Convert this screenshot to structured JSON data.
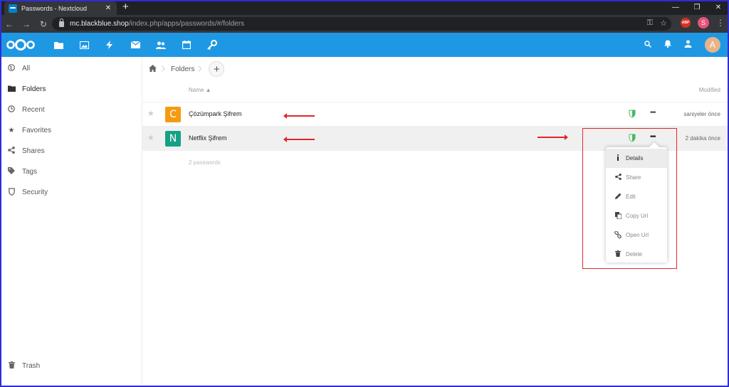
{
  "browser": {
    "tab_title": "Passwords - Nextcloud",
    "new_tab": "+",
    "tab_close": "✕",
    "url_host": "mc.blackblue.shop",
    "url_path": "/index.php/apps/passwords/#/folders",
    "profile_initial": "S",
    "abp_label": "ABP",
    "window_controls": {
      "minimize": "—",
      "maximize": "❐",
      "close": "✕"
    }
  },
  "header": {
    "avatar_initial": "A"
  },
  "sidebar": {
    "items": [
      {
        "label": "All",
        "icon": "globe-icon"
      },
      {
        "label": "Folders",
        "icon": "folder-icon"
      },
      {
        "label": "Recent",
        "icon": "clock-icon"
      },
      {
        "label": "Favorites",
        "icon": "star-icon"
      },
      {
        "label": "Shares",
        "icon": "share-icon"
      },
      {
        "label": "Tags",
        "icon": "tag-icon"
      },
      {
        "label": "Security",
        "icon": "shield-icon"
      }
    ],
    "trash_label": "Trash"
  },
  "breadcrumb": {
    "current": "Folders",
    "add": "+"
  },
  "table": {
    "col_name": "Name ▲",
    "col_modified": "Modified",
    "rows": [
      {
        "letter": "C",
        "letter_color": "#f39c12",
        "title": "Çözümpark Şifrem",
        "modified": "saniyeler önce",
        "shield_color": "#46ba61"
      },
      {
        "letter": "N",
        "letter_color": "#16a085",
        "title": "Netflix Şifrem",
        "modified": "2 dakika önce",
        "shield_color": "#46ba61"
      }
    ],
    "count": "2 passwords"
  },
  "context_menu": {
    "items": [
      {
        "label": "Details",
        "icon": "info-icon"
      },
      {
        "label": "Share",
        "icon": "share-icon"
      },
      {
        "label": "Edit",
        "icon": "pencil-icon"
      },
      {
        "label": "Copy Url",
        "icon": "copy-icon"
      },
      {
        "label": "Open Url",
        "icon": "link-icon"
      },
      {
        "label": "Delete",
        "icon": "trash-icon"
      }
    ]
  },
  "colors": {
    "nextcloud_blue": "#1f98e4",
    "annotation_red": "#e0282a"
  }
}
